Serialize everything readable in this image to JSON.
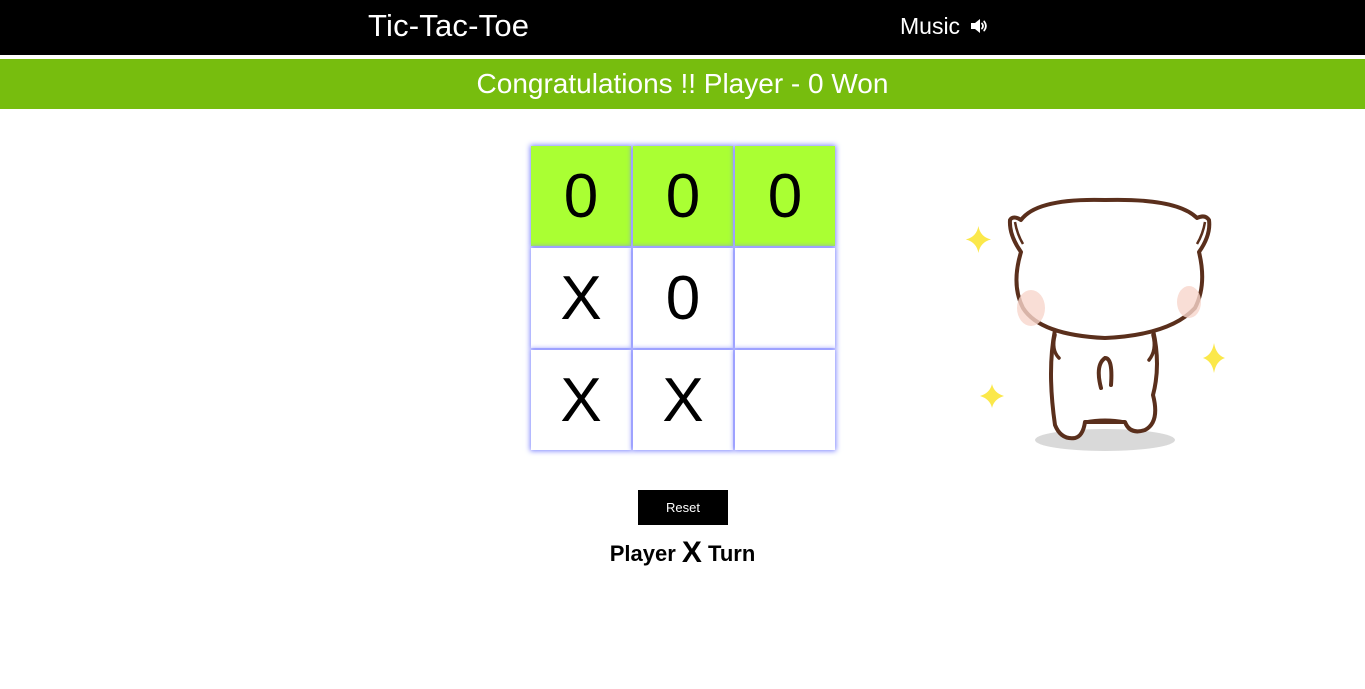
{
  "header": {
    "title": "Tic-Tac-Toe",
    "music_label": "Music",
    "music_icon": "speaker-volume-icon"
  },
  "banner": {
    "message": "Congratulations !! Player - 0 Won",
    "color": "#77bd0e"
  },
  "board": {
    "cells": [
      "0",
      "0",
      "0",
      "X",
      "0",
      "",
      "X",
      "X",
      ""
    ],
    "winning_cells": [
      0,
      1,
      2
    ],
    "win_color": "#aaff33"
  },
  "controls": {
    "reset_label": "Reset"
  },
  "status": {
    "prefix": "Player",
    "player": "X",
    "suffix": "Turn"
  },
  "illustration": {
    "icon": "celebrating-cat-illustration"
  }
}
